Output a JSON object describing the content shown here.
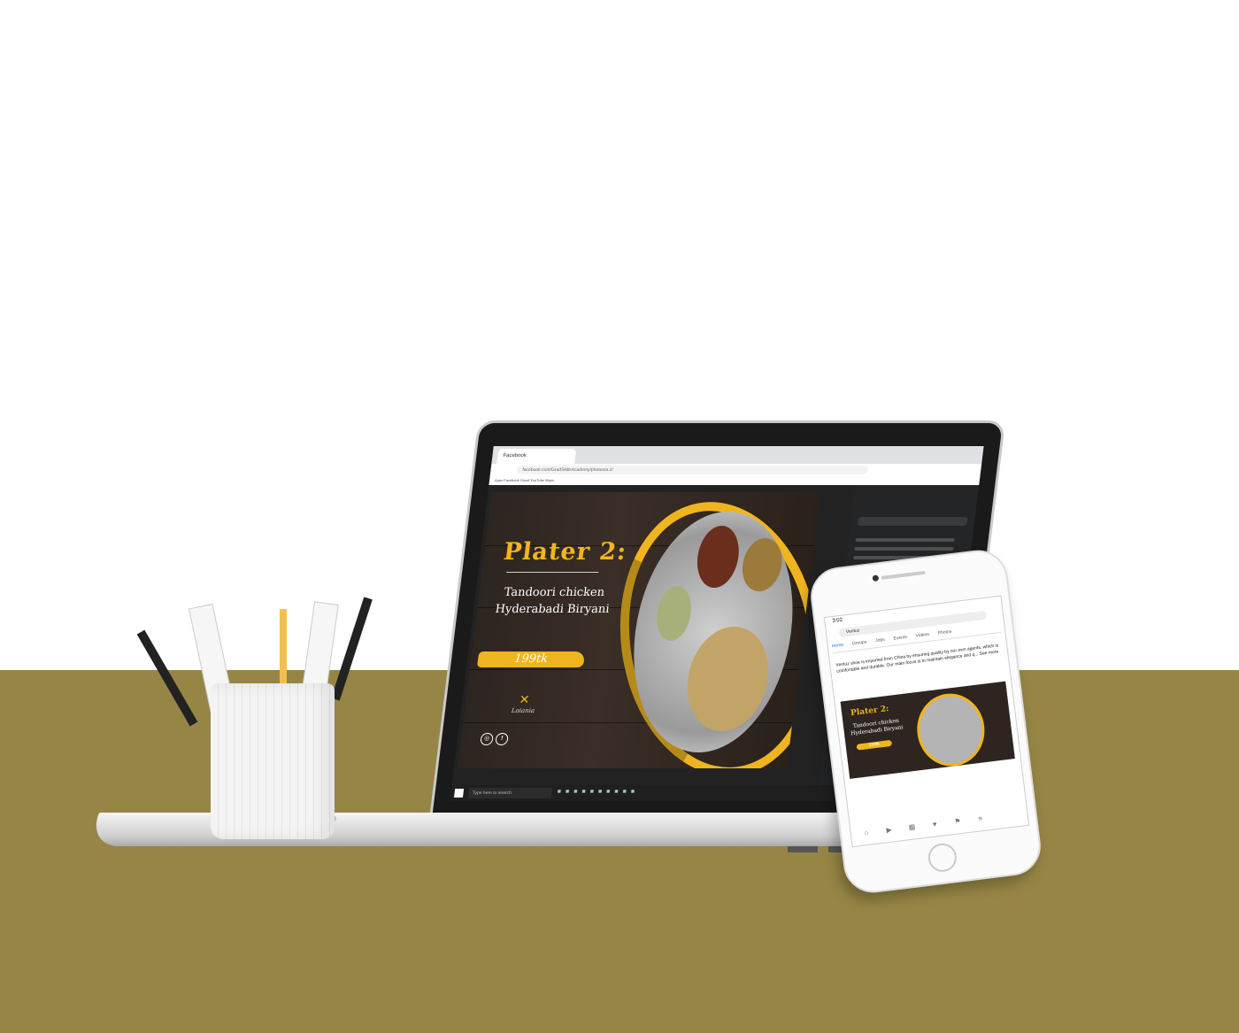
{
  "browser": {
    "tab_label": "Facebook",
    "address": "facebook.com/GradSkillsAcademy/photos/a.1/",
    "bookmarks": "Apps   Facebook   Gmail   YouTube   Maps"
  },
  "banner": {
    "title": "Plater 2:",
    "dish_line1": "Tandoori chicken",
    "dish_line2": "Hyderabadi Biryani",
    "price": "199tk",
    "logo_text": "Loiania",
    "social_instagram": "◎",
    "social_facebook": "f"
  },
  "taskbar": {
    "search_placeholder": "Type here to search"
  },
  "phone": {
    "time": "3:02",
    "search_value": "Ventuz",
    "tabs": [
      "Home",
      "Groups",
      "Jobs",
      "Events",
      "Videos",
      "Photos"
    ],
    "post_text": "Ventuz shoe is imported from China by ensuring quality by our own agents, which is comfortable and durable. Our main focus is to maintain elegance and q... See more",
    "banner_title": "Plater 2:",
    "banner_dish_line1": "Tandoori chicken",
    "banner_dish_line2": "Hyderabadi Biryani",
    "banner_price": "199tk",
    "nav_icons": [
      "⌂",
      "▶",
      "▦",
      "♥",
      "⚑",
      "≡"
    ]
  },
  "colors": {
    "table": "#968544",
    "accent_gold": "#f0b51e",
    "wood": "#2d2520"
  }
}
